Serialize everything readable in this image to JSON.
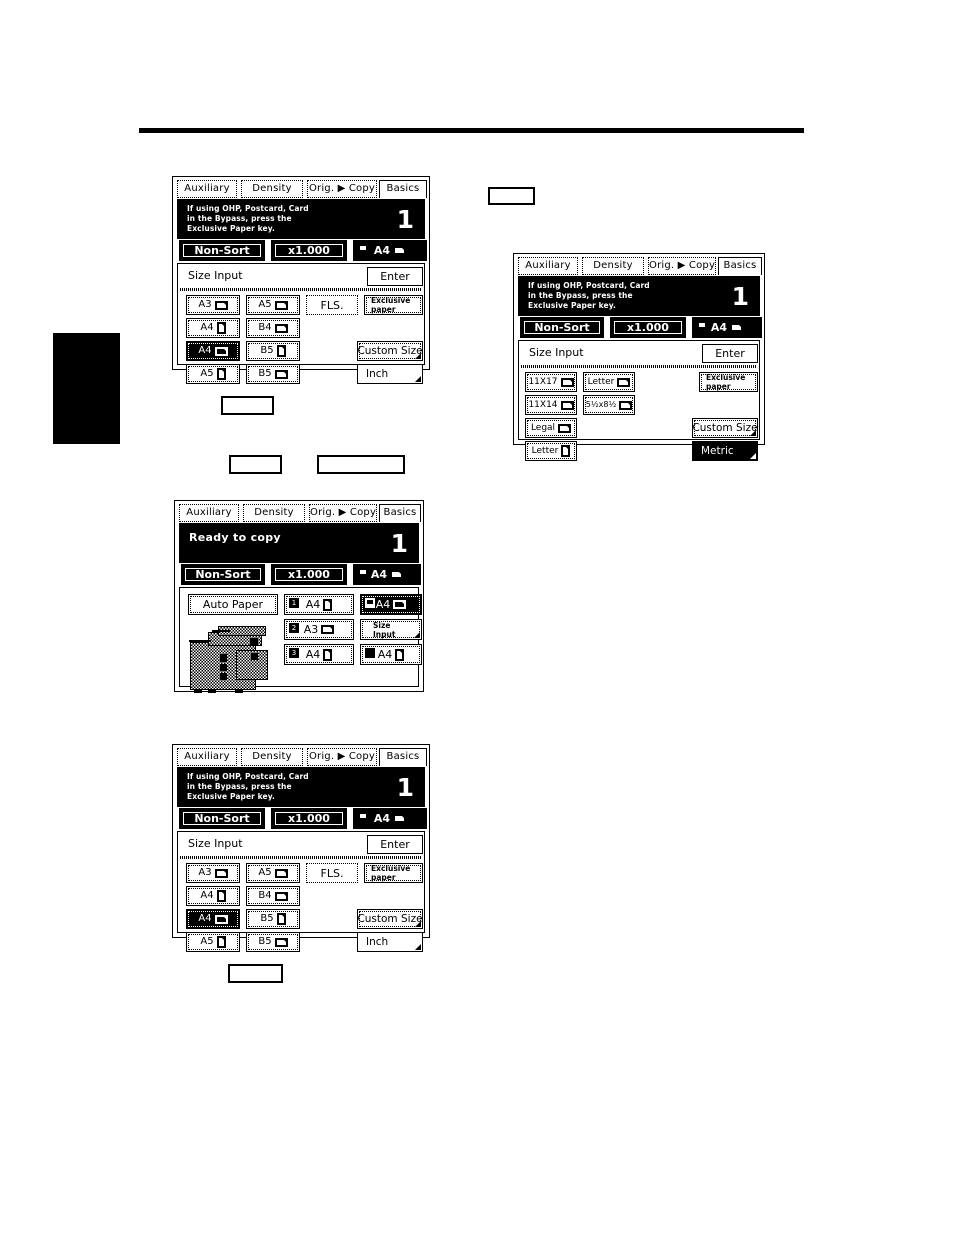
{
  "page": {
    "rule": "horizontal-rule",
    "edge_tab": "chapter-edge-tab"
  },
  "panels": {
    "panel1": {
      "name": "size-input-metric-panel-top",
      "tabs": [
        {
          "label": "Auxiliary",
          "active": false
        },
        {
          "label": "Density",
          "active": false
        },
        {
          "label": "Orig. ▶ Copy",
          "active": false
        },
        {
          "label": "Basics",
          "active": true
        }
      ],
      "message": {
        "line1": "If using OHP, Postcard, Card",
        "line2": "in the  Bypass, press the",
        "line3": "Exclusive Paper key.",
        "count": "1"
      },
      "status": {
        "sort": "Non-Sort",
        "zoom": "x1.000",
        "paper": "A4"
      },
      "section_title": "Size Input",
      "enter_label": "Enter",
      "sizes": [
        {
          "label": "A3",
          "orient": "land",
          "selected": false
        },
        {
          "label": "A5",
          "orient": "land",
          "selected": false
        },
        {
          "label": "A4",
          "orient": "port",
          "selected": false
        },
        {
          "label": "B4",
          "orient": "land",
          "selected": false
        },
        {
          "label": "A4",
          "orient": "land",
          "selected": true
        },
        {
          "label": "B5",
          "orient": "port",
          "selected": false
        },
        {
          "label": "A5",
          "orient": "port",
          "selected": false
        },
        {
          "label": "B5",
          "orient": "land",
          "selected": false
        }
      ],
      "fls_label": "FLS.",
      "exclusive_label_line1": "Exclusive",
      "exclusive_label_line2": "paper",
      "custom_size_label": "Custom Size",
      "unit_toggle_label": "Inch",
      "unit_toggle_selected": false
    },
    "panel2": {
      "name": "size-input-inch-panel",
      "tabs": [
        {
          "label": "Auxiliary",
          "active": false
        },
        {
          "label": "Density",
          "active": false
        },
        {
          "label": "Orig. ▶ Copy",
          "active": false
        },
        {
          "label": "Basics",
          "active": true
        }
      ],
      "message": {
        "line1": "If using OHP, Postcard, Card",
        "line2": "in the  Bypass, press the",
        "line3": "Exclusive Paper key.",
        "count": "1"
      },
      "status": {
        "sort": "Non-Sort",
        "zoom": "x1.000",
        "paper": "A4"
      },
      "section_title": "Size Input",
      "enter_label": "Enter",
      "sizes": [
        {
          "label": "11X17",
          "orient": "land",
          "selected": false
        },
        {
          "label": "Letter",
          "orient": "land",
          "selected": false
        },
        {
          "label": "11X14",
          "orient": "land",
          "selected": false
        },
        {
          "label": "5½x8½",
          "orient": "land",
          "selected": false
        },
        {
          "label": "Legal",
          "orient": "land",
          "selected": false
        },
        {
          "label": "Letter",
          "orient": "port",
          "selected": false
        }
      ],
      "exclusive_label_line1": "Exclusive",
      "exclusive_label_line2": "paper",
      "custom_size_label": "Custom Size",
      "unit_toggle_label": "Metric",
      "unit_toggle_selected": true
    },
    "panel3": {
      "name": "basics-ready-panel",
      "tabs": [
        {
          "label": "Auxiliary",
          "active": false
        },
        {
          "label": "Density",
          "active": false
        },
        {
          "label": "Orig. ▶ Copy",
          "active": false
        },
        {
          "label": "Basics",
          "active": true
        }
      ],
      "message": {
        "big": "Ready to copy",
        "count": "1"
      },
      "status": {
        "sort": "Non-Sort",
        "zoom": "x1.000",
        "paper": "A4"
      },
      "auto_paper_label": "Auto Paper",
      "trays": [
        {
          "tray": "1",
          "label": "A4",
          "orient": "port",
          "selected": false
        },
        {
          "tray": "2",
          "label": "A3",
          "orient": "land",
          "selected": false
        },
        {
          "tray": "3",
          "label": "A4",
          "orient": "port",
          "selected": false
        }
      ],
      "bypass": {
        "label": "A4",
        "orient": "land",
        "selected": true
      },
      "size_input_label_line1": "Size",
      "size_input_label_line2": "Input",
      "lct": {
        "label": "A4",
        "orient": "port",
        "selected": false
      },
      "illustration": "copier-illustration"
    },
    "panel4": {
      "name": "size-input-metric-panel-bottom",
      "tabs": [
        {
          "label": "Auxiliary",
          "active": false
        },
        {
          "label": "Density",
          "active": false
        },
        {
          "label": "Orig. ▶ Copy",
          "active": false
        },
        {
          "label": "Basics",
          "active": true
        }
      ],
      "message": {
        "line1": "If using OHP, Postcard, Card",
        "line2": "in the  Bypass, press the",
        "line3": "Exclusive Paper key.",
        "count": "1"
      },
      "status": {
        "sort": "Non-Sort",
        "zoom": "x1.000",
        "paper": "A4"
      },
      "section_title": "Size Input",
      "enter_label": "Enter",
      "sizes": [
        {
          "label": "A3",
          "orient": "land",
          "selected": false
        },
        {
          "label": "A5",
          "orient": "land",
          "selected": false
        },
        {
          "label": "A4",
          "orient": "port",
          "selected": false
        },
        {
          "label": "B4",
          "orient": "land",
          "selected": false
        },
        {
          "label": "A4",
          "orient": "land",
          "selected": true
        },
        {
          "label": "B5",
          "orient": "port",
          "selected": false
        },
        {
          "label": "A5",
          "orient": "port",
          "selected": false
        },
        {
          "label": "B5",
          "orient": "land",
          "selected": false
        }
      ],
      "fls_label": "FLS.",
      "exclusive_label_line1": "Exclusive",
      "exclusive_label_line2": "paper",
      "custom_size_label": "Custom Size",
      "unit_toggle_label": "Inch",
      "unit_toggle_selected": false
    }
  },
  "callouts": [
    {
      "name": "callout-box-1",
      "text": ""
    },
    {
      "name": "callout-box-2",
      "text": ""
    },
    {
      "name": "callout-box-3",
      "text": ""
    },
    {
      "name": "callout-box-4",
      "text": ""
    },
    {
      "name": "callout-box-5",
      "text": ""
    }
  ]
}
